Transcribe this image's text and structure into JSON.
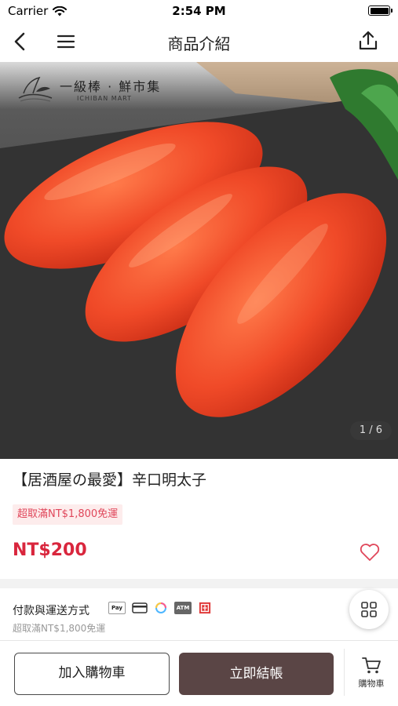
{
  "status_bar": {
    "carrier": "Carrier",
    "time": "2:54 PM"
  },
  "nav": {
    "title": "商品介紹"
  },
  "product_image": {
    "brand_name": "一級棒 · 鮮市集",
    "brand_name_en": "ICHIBAN MART",
    "counter": "1 / 6"
  },
  "product": {
    "title": "【居酒屋の最愛】辛口明太子",
    "promo": "超取滿NT$1,800免運",
    "price": "NT$200"
  },
  "payment_shipping": {
    "title": "付款與運送方式",
    "subtitle": "超取滿NT$1,800免運",
    "icons": [
      "apple-pay-icon",
      "credit-card-icon",
      "line-pay-icon",
      "atm-icon",
      "cash-on-delivery-icon"
    ],
    "atm_label": "ATM",
    "apple_pay_label": "Pay"
  },
  "bottom_bar": {
    "add_to_cart": "加入購物車",
    "buy_now": "立即結帳",
    "cart_label": "購物車"
  },
  "colors": {
    "price": "#d9263d",
    "promo_bg": "#fdecec",
    "buy_button": "#5a4545"
  }
}
